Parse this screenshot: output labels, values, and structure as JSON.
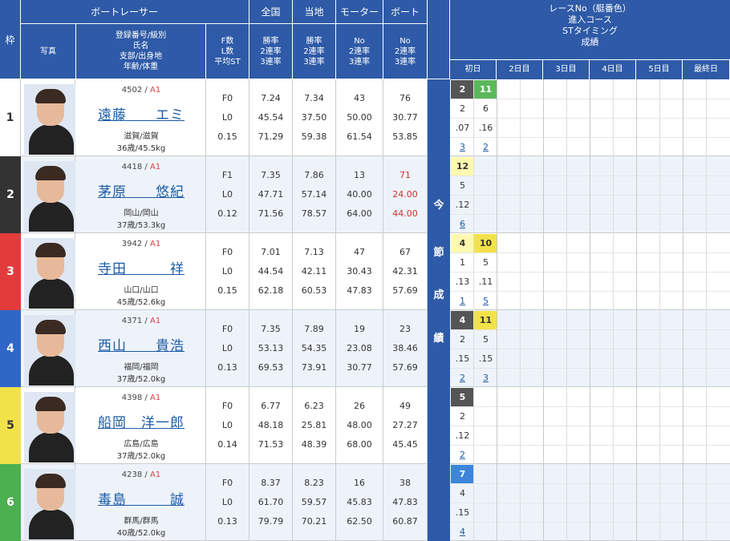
{
  "header": {
    "racer": "ボートレーサー",
    "zenkoku": "全国",
    "touchi": "当地",
    "motor": "モーター",
    "boat": "ボート",
    "waku": "枠",
    "photo": "写真",
    "info_lines": [
      "登録番号/級別",
      "氏名",
      "支部/出身地",
      "年齢/体重"
    ],
    "f_lines": [
      "F数",
      "L数",
      "平均ST"
    ],
    "rate_lines": [
      "勝率",
      "2連率",
      "3連率"
    ],
    "mb_lines": [
      "No",
      "2連率",
      "3連率"
    ],
    "right_lines": [
      "レースNo（艇番色）",
      "進入コース",
      "STタイミング",
      "成績"
    ],
    "days": [
      "初日",
      "2日目",
      "3日目",
      "4日目",
      "5日目",
      "最終日"
    ],
    "konsetsu": [
      "今",
      "節",
      "成",
      "績"
    ]
  },
  "colors": {
    "header": "#2e5aa7",
    "waku": [
      "#ffffff",
      "#333333",
      "#e33b3b",
      "#2e67c6",
      "#f2e24a",
      "#4caf50"
    ]
  },
  "racers": [
    {
      "waku": "1",
      "reg": "4502",
      "cls": "A1",
      "name": "遠藤　　エミ",
      "branch": "滋賀/滋賀",
      "age": "36歳/45.5kg",
      "f": "F0",
      "l": "L0",
      "st": "0.15",
      "z": [
        "7.24",
        "45.54",
        "71.29"
      ],
      "t": [
        "7.34",
        "37.50",
        "59.38"
      ],
      "m": [
        "43",
        "50.00",
        "61.54"
      ],
      "b": [
        "76",
        "30.77",
        "53.85"
      ],
      "bred": false
    },
    {
      "waku": "2",
      "reg": "4418",
      "cls": "A1",
      "name": "茅原　　悠紀",
      "branch": "岡山/岡山",
      "age": "37歳/53.3kg",
      "f": "F1",
      "l": "L0",
      "st": "0.12",
      "z": [
        "7.35",
        "47.71",
        "71.56"
      ],
      "t": [
        "7.86",
        "57.14",
        "78.57"
      ],
      "m": [
        "13",
        "40.00",
        "64.00"
      ],
      "b": [
        "71",
        "24.00",
        "44.00"
      ],
      "bred": true
    },
    {
      "waku": "3",
      "reg": "3942",
      "cls": "A1",
      "name": "寺田　　　祥",
      "branch": "山口/山口",
      "age": "45歳/52.6kg",
      "f": "F0",
      "l": "L0",
      "st": "0.15",
      "z": [
        "7.01",
        "44.54",
        "62.18"
      ],
      "t": [
        "7.13",
        "42.11",
        "60.53"
      ],
      "m": [
        "47",
        "30.43",
        "47.83"
      ],
      "b": [
        "67",
        "42.31",
        "57.69"
      ],
      "bred": false
    },
    {
      "waku": "4",
      "reg": "4371",
      "cls": "A1",
      "name": "西山　　貴浩",
      "branch": "福岡/福岡",
      "age": "37歳/52.0kg",
      "f": "F0",
      "l": "L0",
      "st": "0.13",
      "z": [
        "7.35",
        "53.13",
        "69.53"
      ],
      "t": [
        "7.89",
        "54.35",
        "73.91"
      ],
      "m": [
        "19",
        "23.08",
        "30.77"
      ],
      "b": [
        "23",
        "38.46",
        "57.69"
      ],
      "bred": false
    },
    {
      "waku": "5",
      "reg": "4398",
      "cls": "A1",
      "name": "船岡　洋一郎",
      "branch": "広島/広島",
      "age": "37歳/52.0kg",
      "f": "F0",
      "l": "L0",
      "st": "0.14",
      "z": [
        "6.77",
        "48.18",
        "71.53"
      ],
      "t": [
        "6.23",
        "25.81",
        "48.39"
      ],
      "m": [
        "26",
        "48.00",
        "68.00"
      ],
      "b": [
        "49",
        "27.27",
        "45.45"
      ],
      "bred": false
    },
    {
      "waku": "6",
      "reg": "4238",
      "cls": "A1",
      "name": "毒島　　　誠",
      "branch": "群馬/群馬",
      "age": "40歳/52.0kg",
      "f": "F0",
      "l": "L0",
      "st": "0.13",
      "z": [
        "8.37",
        "61.70",
        "79.79"
      ],
      "t": [
        "8.23",
        "59.57",
        "70.21"
      ],
      "m": [
        "16",
        "45.83",
        "62.50"
      ],
      "b": [
        "38",
        "47.83",
        "60.87"
      ],
      "bred": false
    }
  ],
  "results": [
    [
      {
        "race": "2",
        "course": "2",
        "st": ".07",
        "rank": "3",
        "style": "hl"
      },
      {
        "race": "11",
        "course": "6",
        "st": ".16",
        "rank": "2",
        "style": "hlg"
      }
    ],
    [
      {
        "race": "12",
        "course": "5",
        "st": ".12",
        "rank": "6",
        "style": "hlw"
      }
    ],
    [
      {
        "race": "4",
        "course": "1",
        "st": ".13",
        "rank": "1",
        "style": "hlw"
      },
      {
        "race": "10",
        "course": "5",
        "st": ".11",
        "rank": "5",
        "style": "hly"
      }
    ],
    [
      {
        "race": "4",
        "course": "2",
        "st": ".15",
        "rank": "2",
        "style": "hl"
      },
      {
        "race": "11",
        "course": "5",
        "st": ".15",
        "rank": "3",
        "style": "hly"
      }
    ],
    [
      {
        "race": "5",
        "course": "2",
        "st": ".12",
        "rank": "2",
        "style": "hl"
      }
    ],
    [
      {
        "race": "7",
        "course": "4",
        "st": ".15",
        "rank": "4",
        "style": "hlb"
      }
    ]
  ]
}
